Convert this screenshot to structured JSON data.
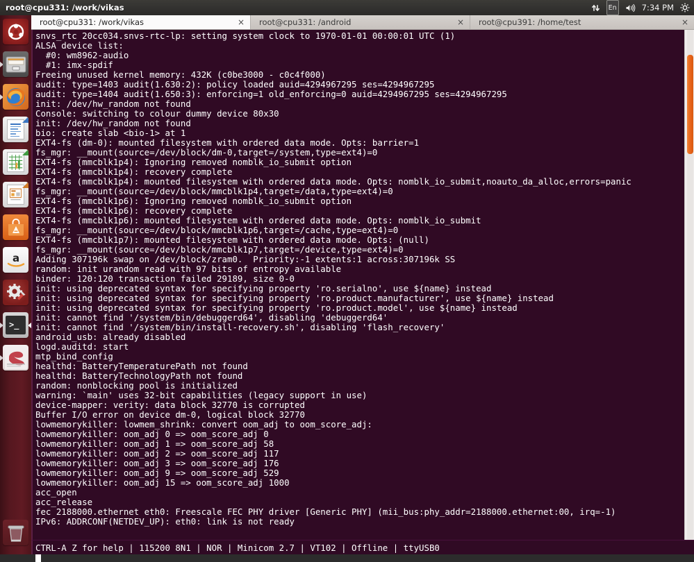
{
  "panel": {
    "title": "root@cpu331: /work/vikas",
    "indicators": [
      {
        "name": "network-icon",
        "glyph": "↑↓"
      },
      {
        "name": "keyboard-indicator",
        "label": "En"
      },
      {
        "name": "volume-icon",
        "glyph": "🔊"
      },
      {
        "name": "clock",
        "label": "7:34 PM"
      },
      {
        "name": "session-gear-icon",
        "glyph": "⚙"
      }
    ],
    "clock": "7:34 PM",
    "keyboard_layout": "En"
  },
  "launcher": {
    "items": [
      {
        "name": "ubuntu-dash-icon",
        "label": "Ubuntu Dash",
        "running": false,
        "focused": false
      },
      {
        "name": "files-icon",
        "label": "Files",
        "running": true,
        "focused": false
      },
      {
        "name": "firefox-icon",
        "label": "Firefox Web Browser",
        "running": true,
        "focused": false
      },
      {
        "name": "libreoffice-writer-icon",
        "label": "LibreOffice Writer",
        "running": false,
        "focused": false
      },
      {
        "name": "libreoffice-calc-icon",
        "label": "LibreOffice Calc",
        "running": false,
        "focused": false
      },
      {
        "name": "libreoffice-impress-icon",
        "label": "LibreOffice Impress",
        "running": false,
        "focused": false
      },
      {
        "name": "ubuntu-software-center-icon",
        "label": "Ubuntu Software Center",
        "running": false,
        "focused": false
      },
      {
        "name": "amazon-icon",
        "label": "Amazon",
        "running": false,
        "focused": false
      },
      {
        "name": "system-settings-icon",
        "label": "System Settings",
        "running": false,
        "focused": false
      },
      {
        "name": "terminal-icon",
        "label": "Terminal",
        "running": true,
        "focused": true
      },
      {
        "name": "emacs-icon",
        "label": "Emacs",
        "running": true,
        "focused": false
      },
      {
        "name": "trash-icon",
        "label": "Trash",
        "running": false,
        "focused": false
      }
    ]
  },
  "window": {
    "tabs": [
      {
        "title": "root@cpu331: /work/vikas",
        "active": true,
        "close": "×"
      },
      {
        "title": "root@cpu331: /android",
        "active": false,
        "close": "×"
      },
      {
        "title": "root@cpu391: /home/test",
        "active": false,
        "close": "×"
      }
    ]
  },
  "terminal": {
    "background_color": "#300a24",
    "text_color": "#ffffff",
    "lines": [
      "snvs_rtc 20cc034.snvs-rtc-lp: setting system clock to 1970-01-01 00:00:01 UTC (1)",
      "ALSA device list:",
      "  #0: wm8962-audio",
      "  #1: imx-spdif",
      "Freeing unused kernel memory: 432K (c0be3000 - c0c4f000)",
      "audit: type=1403 audit(1.630:2): policy loaded auid=4294967295 ses=4294967295",
      "audit: type=1404 audit(1.650:3): enforcing=1 old_enforcing=0 auid=4294967295 ses=4294967295",
      "init: /dev/hw_random not found",
      "Console: switching to colour dummy device 80x30",
      "init: /dev/hw_random not found",
      "bio: create slab <bio-1> at 1",
      "EXT4-fs (dm-0): mounted filesystem with ordered data mode. Opts: barrier=1",
      "fs_mgr: __mount(source=/dev/block/dm-0,target=/system,type=ext4)=0",
      "EXT4-fs (mmcblk1p4): Ignoring removed nomblk_io_submit option",
      "EXT4-fs (mmcblk1p4): recovery complete",
      "EXT4-fs (mmcblk1p4): mounted filesystem with ordered data mode. Opts: nomblk_io_submit,noauto_da_alloc,errors=panic",
      "fs_mgr: __mount(source=/dev/block/mmcblk1p4,target=/data,type=ext4)=0",
      "EXT4-fs (mmcblk1p6): Ignoring removed nomblk_io_submit option",
      "EXT4-fs (mmcblk1p6): recovery complete",
      "EXT4-fs (mmcblk1p6): mounted filesystem with ordered data mode. Opts: nomblk_io_submit",
      "fs_mgr: __mount(source=/dev/block/mmcblk1p6,target=/cache,type=ext4)=0",
      "EXT4-fs (mmcblk1p7): mounted filesystem with ordered data mode. Opts: (null)",
      "fs_mgr: __mount(source=/dev/block/mmcblk1p7,target=/device,type=ext4)=0",
      "Adding 307196k swap on /dev/block/zram0.  Priority:-1 extents:1 across:307196k SS",
      "random: init urandom read with 97 bits of entropy available",
      "binder: 120:120 transaction failed 29189, size 0-0",
      "init: using deprecated syntax for specifying property 'ro.serialno', use ${name} instead",
      "init: using deprecated syntax for specifying property 'ro.product.manufacturer', use ${name} instead",
      "init: using deprecated syntax for specifying property 'ro.product.model', use ${name} instead",
      "init: cannot find '/system/bin/debuggerd64', disabling 'debuggerd64'",
      "init: cannot find '/system/bin/install-recovery.sh', disabling 'flash_recovery'",
      "android_usb: already disabled",
      "logd.auditd: start",
      "mtp_bind_config",
      "healthd: BatteryTemperaturePath not found",
      "healthd: BatteryTechnologyPath not found",
      "random: nonblocking pool is initialized",
      "warning: `main' uses 32-bit capabilities (legacy support in use)",
      "device-mapper: verity: data block 32770 is corrupted",
      "Buffer I/O error on device dm-0, logical block 32770",
      "lowmemorykiller: lowmem_shrink: convert oom_adj to oom_score_adj:",
      "lowmemorykiller: oom_adj 0 => oom_score_adj 0",
      "lowmemorykiller: oom_adj 1 => oom_score_adj 58",
      "lowmemorykiller: oom_adj 2 => oom_score_adj 117",
      "lowmemorykiller: oom_adj 3 => oom_score_adj 176",
      "lowmemorykiller: oom_adj 9 => oom_score_adj 529",
      "lowmemorykiller: oom_adj 15 => oom_score_adj 1000",
      "acc_open",
      "acc_release",
      "fec 2188000.ethernet eth0: Freescale FEC PHY driver [Generic PHY] (mii_bus:phy_addr=2188000.ethernet:00, irq=-1)",
      "IPv6: ADDRCONF(NETDEV_UP): eth0: link is not ready"
    ]
  },
  "statusbar": {
    "text": "CTRL-A Z for help | 115200 8N1 | NOR | Minicom 2.7 | VT102 | Offline | ttyUSB0",
    "help": "CTRL-A Z for help",
    "baud": "115200 8N1",
    "flow": "NOR",
    "program": "Minicom 2.7",
    "emulation": "VT102",
    "connection": "Offline",
    "device": "ttyUSB0"
  },
  "scrollbar": {
    "thumb_color": "#e8651a"
  }
}
